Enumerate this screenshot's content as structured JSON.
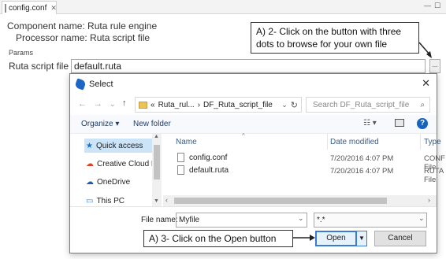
{
  "editor": {
    "tab_title": "config.conf",
    "component_line": "Component name: Ruta rule engine",
    "processor_line": "Processor name: Ruta script file",
    "params_label": "Params",
    "script_file_label": "Ruta script file",
    "script_file_value": "default.ruta",
    "browse_button": "..."
  },
  "callouts": {
    "a2_line1": "A) 2- Click on the button with three",
    "a2_line2": "dots to browse for your own file",
    "a3": "A) 3- Click on the Open button"
  },
  "dialog": {
    "title": "Select",
    "address": {
      "prefix": "«",
      "crumb1": "Ruta_rul...",
      "sep": "›",
      "crumb2": "DF_Ruta_script_file"
    },
    "search_placeholder": "Search DF_Ruta_script_file",
    "toolbar": {
      "organize": "Organize ▾",
      "new_folder": "New folder"
    },
    "nav_items": [
      {
        "label": "Quick access"
      },
      {
        "label": "Creative Cloud Files"
      },
      {
        "label": "OneDrive"
      },
      {
        "label": "This PC"
      }
    ],
    "columns": {
      "name": "Name",
      "date_modified": "Date modified",
      "type": "Type"
    },
    "files": [
      {
        "name": "config.conf",
        "date": "7/20/2016 4:07 PM",
        "type": "CONF File"
      },
      {
        "name": "default.ruta",
        "date": "7/20/2016 4:07 PM",
        "type": "RUTA File"
      }
    ],
    "file_name_label": "File name:",
    "file_name_value": "Myfile",
    "filter_value": "*.*",
    "open_button": "Open",
    "cancel_button": "Cancel"
  },
  "colors": {
    "accent": "#3a7bd5",
    "selection": "#cce4f7"
  }
}
